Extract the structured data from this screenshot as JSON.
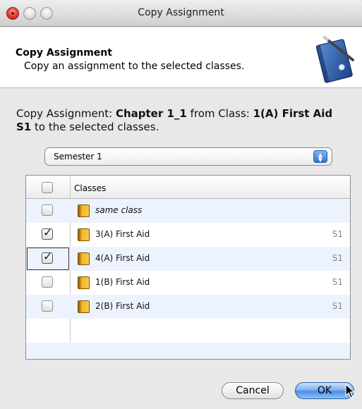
{
  "window": {
    "title": "Copy Assignment"
  },
  "header": {
    "title": "Copy Assignment",
    "subtitle": "Copy an assignment to the selected classes.",
    "icon": "notebook-pen-icon"
  },
  "description": {
    "prefix": "Copy Assignment: ",
    "assignment": "Chapter 1_1",
    "middle": " from Class: ",
    "class_name": "1(A) First Aid S1",
    "suffix": " to the selected classes."
  },
  "semester_select": {
    "value": "Semester 1"
  },
  "table": {
    "column_header": "Classes",
    "rows": [
      {
        "label": "same class",
        "semester": "",
        "checked": false,
        "italic": true
      },
      {
        "label": "3(A) First Aid",
        "semester": "S1",
        "checked": true,
        "italic": false
      },
      {
        "label": "4(A) First Aid",
        "semester": "S1",
        "checked": true,
        "italic": false
      },
      {
        "label": "1(B) First Aid",
        "semester": "S1",
        "checked": false,
        "italic": false
      },
      {
        "label": "2(B) First Aid",
        "semester": "S1",
        "checked": false,
        "italic": false
      }
    ]
  },
  "buttons": {
    "cancel": "Cancel",
    "ok": "OK"
  },
  "colors": {
    "accent": "#4a8fe3",
    "folder": "#f0b52a",
    "row_alt": "#edf3fe"
  }
}
